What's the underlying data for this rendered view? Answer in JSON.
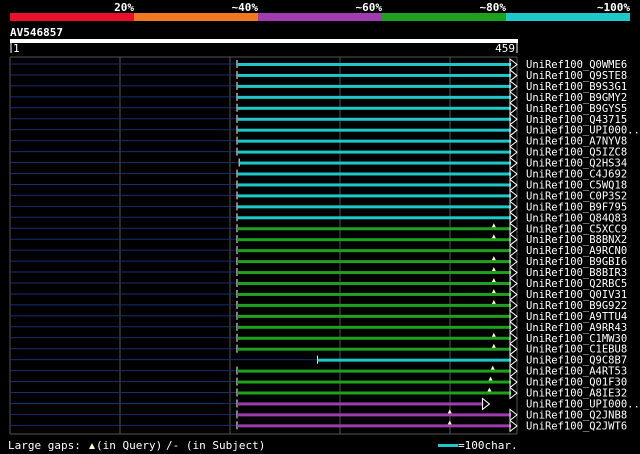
{
  "identity_scale": {
    "labels": [
      "20%",
      "~40%",
      "~60%",
      "~80%",
      "~100%"
    ],
    "colors": [
      "#e8102a",
      "#f07820",
      "#a03cb0",
      "#1ea21e",
      "#1ec8c8"
    ]
  },
  "query": {
    "name": "AV546857",
    "start": "1",
    "end": "459",
    "length": 459
  },
  "chart_data": {
    "type": "alignment_overview",
    "query_length": 459,
    "hits": [
      {
        "name": "UniRef100_Q0WME6",
        "identity_class": "~100%",
        "q_start": 205,
        "q_end": 459,
        "gap_marks": []
      },
      {
        "name": "UniRef100_Q9STE8",
        "identity_class": "~100%",
        "q_start": 205,
        "q_end": 459,
        "gap_marks": []
      },
      {
        "name": "UniRef100_B9S3G1",
        "identity_class": "~100%",
        "q_start": 205,
        "q_end": 459,
        "gap_marks": []
      },
      {
        "name": "UniRef100_B9GMY2",
        "identity_class": "~100%",
        "q_start": 205,
        "q_end": 459,
        "gap_marks": []
      },
      {
        "name": "UniRef100_B9GYS5",
        "identity_class": "~100%",
        "q_start": 205,
        "q_end": 459,
        "gap_marks": []
      },
      {
        "name": "UniRef100_Q43715",
        "identity_class": "~100%",
        "q_start": 205,
        "q_end": 459,
        "gap_marks": []
      },
      {
        "name": "UniRef100_UPI000..",
        "identity_class": "~100%",
        "q_start": 205,
        "q_end": 459,
        "gap_marks": []
      },
      {
        "name": "UniRef100_A7NYV8",
        "identity_class": "~100%",
        "q_start": 205,
        "q_end": 459,
        "gap_marks": []
      },
      {
        "name": "UniRef100_Q5IZC8",
        "identity_class": "~100%",
        "q_start": 205,
        "q_end": 459,
        "gap_marks": []
      },
      {
        "name": "UniRef100_Q2HS34",
        "identity_class": "~100%",
        "q_start": 207,
        "q_end": 459,
        "gap_marks": []
      },
      {
        "name": "UniRef100_C4J692",
        "identity_class": "~100%",
        "q_start": 205,
        "q_end": 459,
        "gap_marks": []
      },
      {
        "name": "UniRef100_C5WQ18",
        "identity_class": "~100%",
        "q_start": 205,
        "q_end": 459,
        "gap_marks": []
      },
      {
        "name": "UniRef100_C0P3S2",
        "identity_class": "~100%",
        "q_start": 205,
        "q_end": 459,
        "gap_marks": []
      },
      {
        "name": "UniRef100_B9F795",
        "identity_class": "~100%",
        "q_start": 205,
        "q_end": 459,
        "gap_marks": []
      },
      {
        "name": "UniRef100_Q84Q83",
        "identity_class": "~100%",
        "q_start": 205,
        "q_end": 459,
        "gap_marks": []
      },
      {
        "name": "UniRef100_C5XCC9",
        "identity_class": "~80%",
        "q_start": 205,
        "q_end": 459,
        "gap_marks": [
          438
        ]
      },
      {
        "name": "UniRef100_B8BNX2",
        "identity_class": "~80%",
        "q_start": 205,
        "q_end": 459,
        "gap_marks": [
          438
        ]
      },
      {
        "name": "UniRef100_A9RCN0",
        "identity_class": "~80%",
        "q_start": 205,
        "q_end": 459,
        "gap_marks": []
      },
      {
        "name": "UniRef100_B9GBI6",
        "identity_class": "~80%",
        "q_start": 205,
        "q_end": 459,
        "gap_marks": [
          438
        ]
      },
      {
        "name": "UniRef100_B8BIR3",
        "identity_class": "~80%",
        "q_start": 205,
        "q_end": 459,
        "gap_marks": [
          438
        ]
      },
      {
        "name": "UniRef100_Q2RBC5",
        "identity_class": "~80%",
        "q_start": 205,
        "q_end": 459,
        "gap_marks": [
          438
        ]
      },
      {
        "name": "UniRef100_Q0IV31",
        "identity_class": "~80%",
        "q_start": 205,
        "q_end": 459,
        "gap_marks": [
          438
        ]
      },
      {
        "name": "UniRef100_B9G922",
        "identity_class": "~80%",
        "q_start": 205,
        "q_end": 459,
        "gap_marks": [
          438
        ]
      },
      {
        "name": "UniRef100_A9TTU4",
        "identity_class": "~80%",
        "q_start": 205,
        "q_end": 459,
        "gap_marks": []
      },
      {
        "name": "UniRef100_A9RR43",
        "identity_class": "~80%",
        "q_start": 205,
        "q_end": 459,
        "gap_marks": []
      },
      {
        "name": "UniRef100_C1MW30",
        "identity_class": "~80%",
        "q_start": 205,
        "q_end": 459,
        "gap_marks": [
          438
        ]
      },
      {
        "name": "UniRef100_C1EBU8",
        "identity_class": "~80%",
        "q_start": 205,
        "q_end": 459,
        "gap_marks": [
          438
        ]
      },
      {
        "name": "UniRef100_Q9C8B7",
        "identity_class": "~100%",
        "q_start": 278,
        "q_end": 459,
        "gap_marks": []
      },
      {
        "name": "UniRef100_A4RT53",
        "identity_class": "~80%",
        "q_start": 205,
        "q_end": 459,
        "gap_marks": [
          437
        ]
      },
      {
        "name": "UniRef100_Q01F30",
        "identity_class": "~80%",
        "q_start": 205,
        "q_end": 459,
        "gap_marks": [
          435
        ]
      },
      {
        "name": "UniRef100_A8IE32",
        "identity_class": "~80%",
        "q_start": 205,
        "q_end": 459,
        "gap_marks": [
          434
        ]
      },
      {
        "name": "UniRef100_UPI000..",
        "identity_class": "~60%",
        "q_start": 205,
        "q_end": 434,
        "gap_marks": []
      },
      {
        "name": "UniRef100_Q2JNB8",
        "identity_class": "~60%",
        "q_start": 205,
        "q_end": 459,
        "gap_marks": [
          398
        ]
      },
      {
        "name": "UniRef100_Q2JWT6",
        "identity_class": "~60%",
        "q_start": 205,
        "q_end": 459,
        "gap_marks": [
          398
        ]
      }
    ]
  },
  "legend": {
    "gaps_prefix": "Large gaps: ",
    "gaps_query": "(in Query)",
    "gaps_subject": "/- (in Subject)",
    "scale_text": "=100char.",
    "scale_color": "#1ec8c8",
    "gap_marker_color": "#fffcc0"
  }
}
